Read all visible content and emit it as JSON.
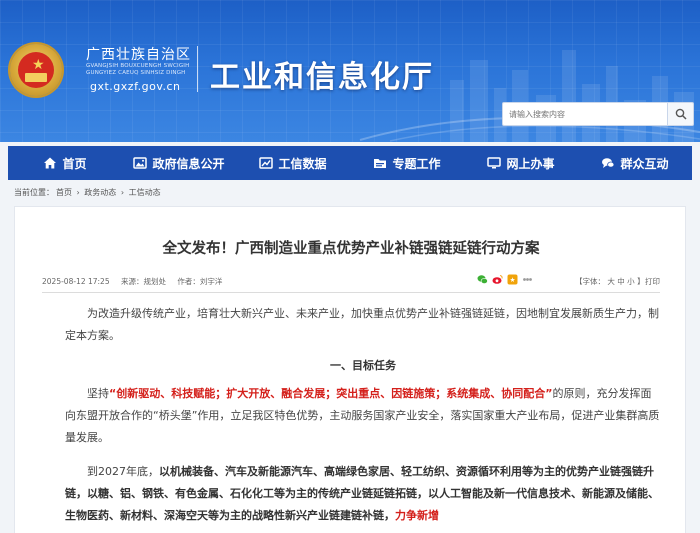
{
  "header": {
    "region_name": "广西壮族自治区",
    "region_zhuang": "GVANGJSIH BOUXCUENGH SWCIGIH GUNGYIEZ CAEUQ SINHSIZ DINGH",
    "domain": "gxt.gxzf.gov.cn",
    "dept_title": "工业和信息化厅",
    "search_placeholder": "请输入搜索内容",
    "emblem": "emblem-icon"
  },
  "colors": {
    "banner": "#2b74d8",
    "nav": "#1d4fb0",
    "accent_red": "#d4201b"
  },
  "nav": {
    "items": [
      {
        "label": "首页",
        "icon": "home-icon"
      },
      {
        "label": "政府信息公开",
        "icon": "image-icon"
      },
      {
        "label": "工信数据",
        "icon": "chart-icon"
      },
      {
        "label": "专题工作",
        "icon": "folder-icon"
      },
      {
        "label": "网上办事",
        "icon": "monitor-icon"
      },
      {
        "label": "群众互动",
        "icon": "chat-icon"
      }
    ]
  },
  "breadcrumb": {
    "prefix": "当前位置：",
    "items": [
      "首页",
      "政务动态",
      "工信动态"
    ],
    "separator": "›"
  },
  "article": {
    "title": "全文发布！广西制造业重点优势产业补链强链延链行动方案",
    "date": "2025-08-12 17:25",
    "source": "来源：规划处",
    "author": "作者：刘宇洋",
    "share_icons": [
      "wechat-icon",
      "weibo-icon",
      "qzone-icon",
      "more-share-icon"
    ],
    "font_size_label": "【字体：",
    "font_large": "大",
    "font_medium": "中",
    "font_small": "小",
    "font_size_end": "】",
    "print": "打印",
    "para1": "为改造升级传统产业，培育壮大新兴产业、未来产业，加快重点优势产业补链强链延链，因地制宜发展新质生产力，制定本方案。",
    "section_heading": "一、目标任务",
    "para2_lead": "坚持",
    "para2_red": "“创新驱动、科技赋能；扩大开放、融合发展；突出重点、因链施策；系统集成、协同配合”",
    "para2_rest": "的原则，充分发挥面向东盟开放合作的“桥头堡”作用，立足我区特色优势，主动服务国家产业安全，落实国家重大产业布局，促进产业集群高质量发展。",
    "para3_lead": "到2027年底，",
    "para3_bold": "以机械装备、汽车及新能源汽车、高端绿色家居、轻工纺织、资源循环利用等为主的优势产业链强链升链，以糖、铝、钢铁、有色金属、石化化工等为主的传统产业链延链拓链，以人工智能及新一代信息技术、新能源及储能、生物医药、新材料、深海空天等为主的战略性新兴产业链建链补链，",
    "para3_red": "力争新增"
  }
}
